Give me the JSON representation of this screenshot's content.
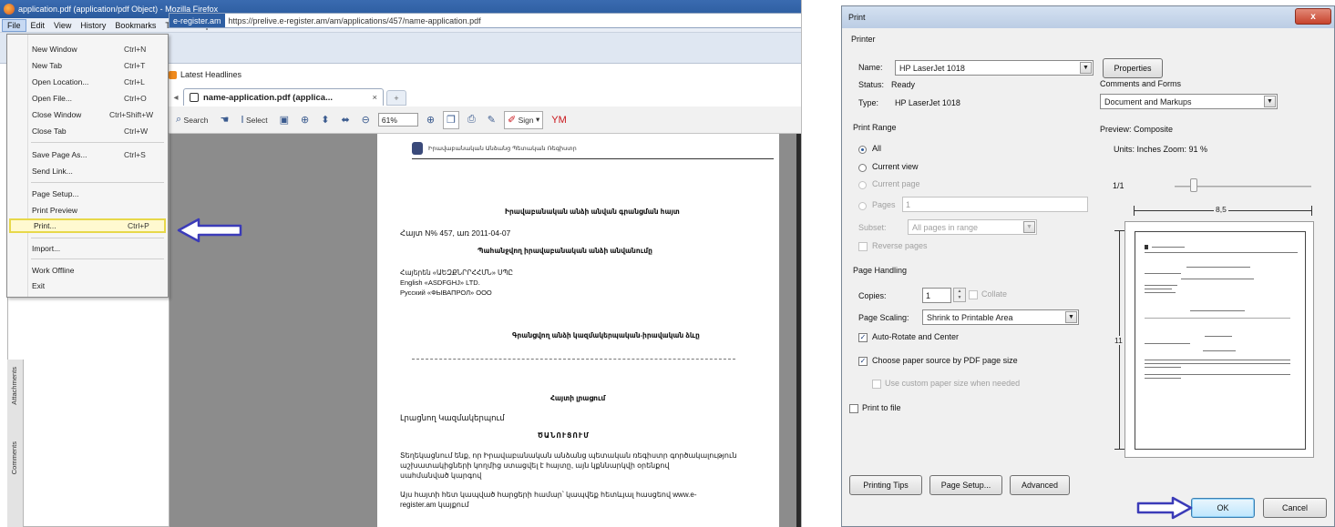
{
  "firefox": {
    "window_title": "application.pdf (application/pdf Object) - Mozilla Firefox",
    "menubar": [
      "File",
      "Edit",
      "View",
      "History",
      "Bookmarks",
      "Tools",
      "Help"
    ],
    "url_site": "e-register.am",
    "url": "https://prelive.e-register.am/am/applications/457/name-application.pdf",
    "bookmark": "Latest Headlines",
    "tab_title": "name-application.pdf (applica...",
    "tab_close": "×",
    "new_tab": "+",
    "toolbar": {
      "search": "Search",
      "select": "Select",
      "zoom": "61%",
      "sign": "Sign",
      "pdf_brand": "YM"
    },
    "nav_tabs": [
      "Attachments",
      "Comments"
    ],
    "file_menu": [
      {
        "label": "New Window",
        "shortcut": "Ctrl+N"
      },
      {
        "label": "New Tab",
        "shortcut": "Ctrl+T"
      },
      {
        "label": "Open Location...",
        "shortcut": "Ctrl+L"
      },
      {
        "label": "Open File...",
        "shortcut": "Ctrl+O"
      },
      {
        "label": "Close Window",
        "shortcut": "Ctrl+Shift+W"
      },
      {
        "label": "Close Tab",
        "shortcut": "Ctrl+W"
      },
      {
        "label": "Save Page As...",
        "shortcut": "Ctrl+S"
      },
      {
        "label": "Send Link...",
        "shortcut": ""
      },
      {
        "label": "Page Setup...",
        "shortcut": ""
      },
      {
        "label": "Print Preview",
        "shortcut": ""
      },
      {
        "label": "Print...",
        "shortcut": "Ctrl+P",
        "highlighted": true
      },
      {
        "label": "Import...",
        "shortcut": ""
      },
      {
        "label": "Work Offline",
        "shortcut": ""
      },
      {
        "label": "Exit",
        "shortcut": ""
      }
    ],
    "pdf": {
      "header": "Իրավաբանական Անձանց Պետական Ռեգիստր",
      "title": "Իրավաբանական անձի անվան գրանցման հայտ",
      "case": "Հայտ N% 457, առ 2011-04-07",
      "subtitle": "Պահանջվող իրավաբանական անձի անվանումը",
      "lines": [
        "Հայերեն «ԱԵԶՔՆՐՐՀՀՄՆ» ՍՊԸ",
        "English «ASDFGHJ» LTD.",
        "Русский «ФЫВАПРОЛ» ООО"
      ],
      "section2": "Գրանցվող անձի կազմակերպական-իրավական ձևը",
      "section3": "Հայտի լրացում",
      "applicant": "Լրացնող Կազմակերպում",
      "notice": "ԾԱՆՈՒՑՈՒՄ",
      "para1": "Տեղեկացնում ենք, որ Իրավաբանական անձանց պետական ռեգիստր գործակալություն",
      "para1b": "աշխատակիցների կողմից ստացվել է հայտը, այն կքննարկվի օրենքով",
      "para1c": "սահմանված կարգով",
      "para2": "Այս հայտի հետ կապված հարցերի համար՝ կապվեք հետևյալ հասցեով www.e-",
      "para2b": "register.am կայքում"
    }
  },
  "print_dialog": {
    "title": "Print",
    "close": "x",
    "printer_section": "Printer",
    "name_label": "Name:",
    "name_value": "HP LaserJet 1018",
    "properties": "Properties",
    "status_label": "Status:",
    "status_value": "Ready",
    "type_label": "Type:",
    "type_value": "HP LaserJet 1018",
    "comments_label": "Comments and Forms",
    "comments_value": "Document and Markups",
    "print_range": "Print Range",
    "range_all": "All",
    "range_current_view": "Current view",
    "range_current_page": "Current page",
    "range_pages": "Pages",
    "pages_value": "1",
    "subset_label": "Subset:",
    "subset_value": "All pages in range",
    "reverse_pages": "Reverse pages",
    "page_handling": "Page Handling",
    "copies_label": "Copies:",
    "copies_value": "1",
    "collate": "Collate",
    "page_scaling_label": "Page Scaling:",
    "page_scaling_value": "Shrink to Printable Area",
    "auto_rotate": "Auto-Rotate and Center",
    "choose_paper": "Choose paper source by PDF page size",
    "custom_paper": "Use custom paper size when needed",
    "print_to_file": "Print to file",
    "preview_label": "Preview: Composite",
    "units": "Units: Inches Zoom:  91 %",
    "page_counter": "1/1",
    "width_dim": "8,5",
    "height_dim": "11",
    "printing_tips": "Printing Tips",
    "page_setup": "Page Setup...",
    "advanced": "Advanced",
    "ok": "OK",
    "cancel": "Cancel"
  }
}
